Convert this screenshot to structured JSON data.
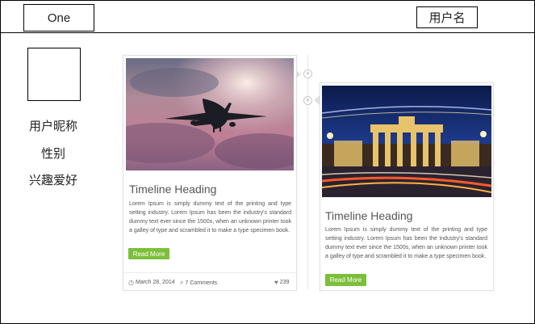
{
  "header": {
    "logo_text": "One",
    "username": "用户名"
  },
  "profile": {
    "nickname": "用户昵称",
    "gender": "性别",
    "interests": "兴趣爱好"
  },
  "posts": [
    {
      "title": "Timeline Heading",
      "body": "Lorem Ipsum is simply dummy text of the printing and type setting industry. Lorem Ipsum has been the industry's standard dummy text ever since the 1500s, when an unknown printer took a galley of type and scrambled it to make a type specimen book.",
      "button": "Read More",
      "date": "March 28, 2014",
      "comments": "7 Comments",
      "likes": "239",
      "image": "airplane-photo"
    },
    {
      "title": "Timeline Heading",
      "body": "Lorem Ipsum is simply dummy text of the printing and type setting industry. Lorem Ipsum has been the industry's standard dummy text ever since the 1500s, when an unknown printer took a galley of type and scrambled it to make a type specimen book.",
      "button": "Read More",
      "image": "brandenburg-gate-night-photo"
    }
  ],
  "colors": {
    "button_green": "#7cbf3a",
    "border": "#000000",
    "card_border": "#e2e2e2"
  }
}
